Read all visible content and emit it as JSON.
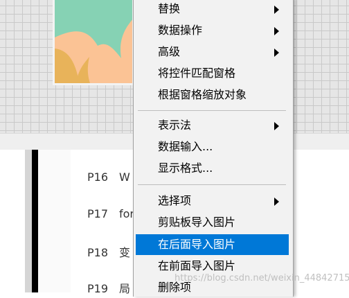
{
  "params": [
    {
      "id": "P16",
      "text": "W"
    },
    {
      "id": "P17",
      "text": "for"
    },
    {
      "id": "P18",
      "text": "变"
    },
    {
      "id": "P19",
      "text": "局"
    }
  ],
  "context_menu": {
    "items": [
      {
        "label": "替换",
        "submenu": true
      },
      {
        "label": "数据操作",
        "submenu": true
      },
      {
        "label": "高级",
        "submenu": true
      },
      {
        "label": "将控件匹配窗格",
        "submenu": false
      },
      {
        "label": "根据窗格缩放对象",
        "submenu": false
      },
      {
        "label": "表示法",
        "submenu": true
      },
      {
        "label": "数据输入...",
        "submenu": false
      },
      {
        "label": "显示格式...",
        "submenu": false
      },
      {
        "label": "选择项",
        "submenu": true
      },
      {
        "label": "剪贴板导入图片",
        "submenu": false
      },
      {
        "label": "在后面导入图片",
        "submenu": false,
        "highlighted": true
      },
      {
        "label": "在前面导入图片",
        "submenu": false
      },
      {
        "label": "删除项",
        "submenu": false
      }
    ]
  },
  "watermark": "https://blog.csdn.net/weixin_44842715",
  "colors": {
    "highlight": "#0078d7",
    "menu_bg": "#f2f2f2",
    "image_mint": "#86d2b4",
    "image_peach": "#fbc395",
    "image_orange": "#e8b35a"
  }
}
